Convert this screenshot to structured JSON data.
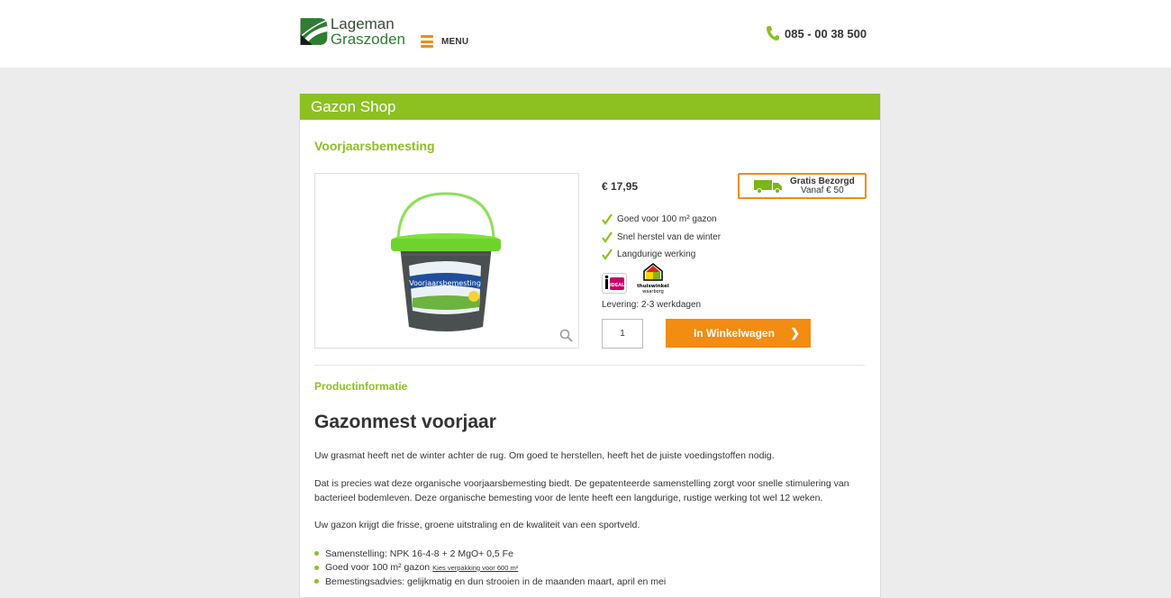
{
  "header": {
    "logo_line1": "Lageman",
    "logo_line2": "Graszoden",
    "menu_label": "MENU",
    "phone": "085 - 00 38 500"
  },
  "shop": {
    "title": "Gazon Shop"
  },
  "product": {
    "name": "Voorjaarsbemesting",
    "price": "€ 17,95",
    "free_delivery_title": "Gratis Bezorgd",
    "free_delivery_sub": "Vanaf € 50",
    "usps": [
      "Goed voor 100 m² gazon",
      "Snel herstel van de winter",
      "Langdurige werking"
    ],
    "trust_ideal": "iDEAL",
    "trust_thuis_line1": "thuiswinkel",
    "trust_thuis_line2": "waarborg",
    "delivery": "Levering: 2-3 werkdagen",
    "quantity": "1",
    "cart_button": "In Winkelwagen",
    "cart_chevron": "❯",
    "bucket_label": "Voorjaarsbemesting"
  },
  "info": {
    "section_title": "Productinformatie",
    "heading": "Gazonmest voorjaar",
    "paragraphs": [
      "Uw grasmat heeft net de winter achter de rug. Om goed te herstellen, heeft het de juiste voedingstoffen nodig.",
      "Dat is precies wat deze organische voorjaarsbemesting biedt. De gepatenteerde samenstelling zorgt voor snelle stimulering van bacterieel bodemleven. Deze organische bemesting voor de lente heeft een langdurige, rustige werking tot wel 12 weken.",
      "Uw gazon krijgt die frisse, groene uitstraling en de kwaliteit van een sportveld."
    ],
    "specs": [
      "Samenstelling: NPK 16-4-8 + 2 MgO+ 0,5 Fe",
      "Goed voor 100 m² gazon",
      "Bemestingsadvies: gelijkmatig en dun strooien in de maanden maart, april en mei"
    ],
    "spec_link": "Kies verpakking voor 600 m²"
  },
  "colors": {
    "brand_green": "#8dc021",
    "accent_orange": "#f28c12"
  }
}
